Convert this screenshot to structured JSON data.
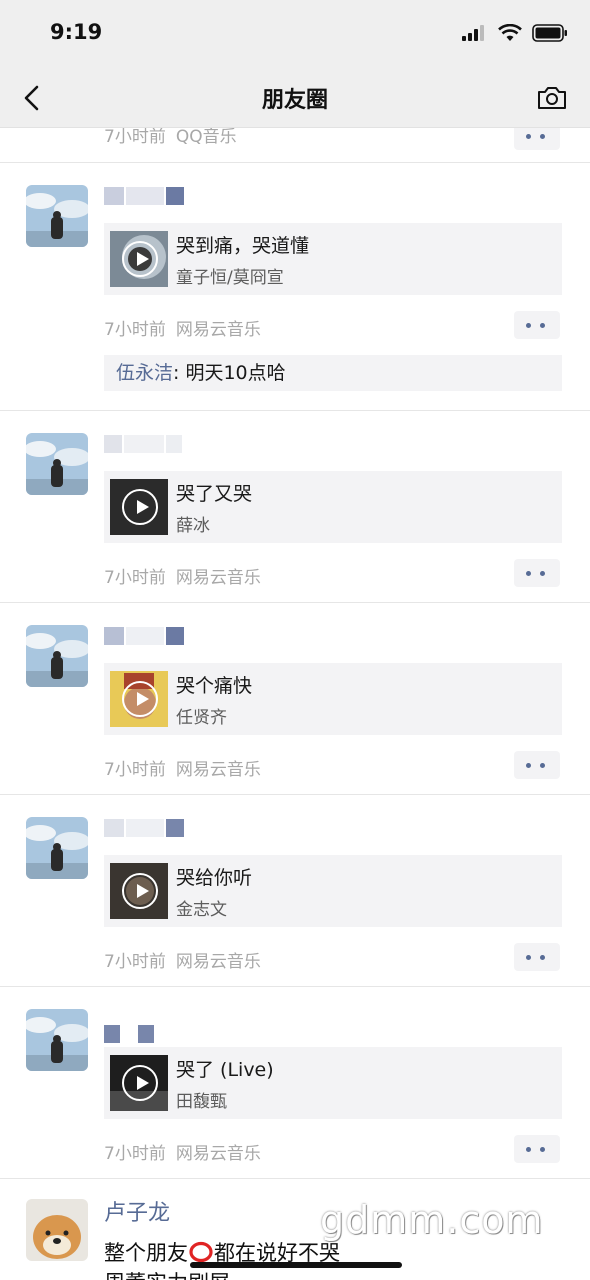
{
  "status_bar": {
    "time": "9:19"
  },
  "nav": {
    "title": "朋友圈"
  },
  "colors": {
    "link": "#576b95",
    "meta_gray": "#a8a8a8",
    "card_bg": "#f3f3f5",
    "bar_bg": "#efefef"
  },
  "partial_post": {
    "time": "7小时前",
    "source": "QQ音乐"
  },
  "posts": [
    {
      "song": "哭到痛，哭道懂",
      "artist": "童子恒/莫冏宣",
      "time": "7小时前",
      "source": "网易云音乐",
      "comment": {
        "user": "伍永洁",
        "text": ": 明天10点哈"
      }
    },
    {
      "song": "哭了又哭",
      "artist": "薛冰",
      "time": "7小时前",
      "source": "网易云音乐"
    },
    {
      "song": "哭个痛快",
      "artist": "任贤齐",
      "time": "7小时前",
      "source": "网易云音乐"
    },
    {
      "song": "哭给你听",
      "artist": "金志文",
      "time": "7小时前",
      "source": "网易云音乐"
    },
    {
      "song": "哭了 (Live)",
      "artist": "田馥甄",
      "time": "7小时前",
      "source": "网易云音乐"
    }
  ],
  "last_post": {
    "name": "卢子龙",
    "text_line1": "整个朋友",
    "text_line1_rest": "都在说好不哭",
    "text_line2": "周董实力刷屏"
  },
  "watermark": "gdmm.com"
}
